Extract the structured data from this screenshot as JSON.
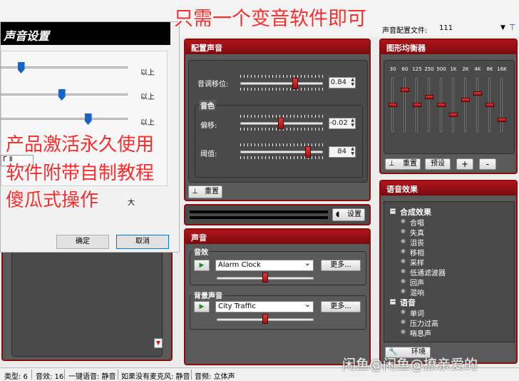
{
  "top": {
    "config_file_label": "声音配置文件:",
    "config_file_value": "111"
  },
  "overlay": {
    "headline": "只需一个变音软件即可",
    "line1": "产品激活永久使用",
    "line2": "软件附带自制教程",
    "line3": "傻瓜式操作"
  },
  "dialog": {
    "title": "声音设置",
    "row_labels": [
      "以上",
      "以上",
      "以上"
    ],
    "slider_levels": [
      0.14,
      0.48,
      0.7
    ],
    "combo_value": "Γ Ⅱ",
    "size_label": "大",
    "ok_label": "确定",
    "cancel_label": "取消"
  },
  "voice_config": {
    "title": "配置声音",
    "pitch_label": "音调移位:",
    "pitch_value": "0.84",
    "pitch_level": 0.68,
    "timbre_group": "音色",
    "offset_label": "偏移:",
    "offset_value": "-0.02",
    "offset_level": 0.49,
    "threshold_label": "阈值:",
    "threshold_value": "84",
    "threshold_level": 0.84,
    "reset_label": "重置"
  },
  "monitor": {
    "settings_label": "设置"
  },
  "sound": {
    "title": "声音",
    "effects_group": "音效",
    "effect_value": "Alarm Clock",
    "effect_more": "更多...",
    "effect_level": 0.5,
    "bg_group": "背景声音",
    "bg_value": "City Traffic",
    "bg_more": "更多...",
    "bg_level": 0.5
  },
  "equalizer": {
    "title": "图形均衡器",
    "bands": [
      "30",
      "60",
      "125",
      "250",
      "500",
      "1K",
      "2K",
      "4K",
      "8K",
      "16K"
    ],
    "levels": [
      0.5,
      0.8,
      0.5,
      0.66,
      0.5,
      0.3,
      0.6,
      0.73,
      0.5,
      0.2
    ],
    "reset_label": "重置",
    "preset_label": "预设",
    "plus_label": "+",
    "minus_label": "-"
  },
  "voice_effects": {
    "title": "语音效果",
    "group1": "合成效果",
    "items1": [
      "合唱",
      "失真",
      "沮丧",
      "移相",
      "采样",
      "低通滤波器",
      "回声",
      "混响"
    ],
    "group2": "语音",
    "items2": [
      "单词",
      "压力过高",
      "喘息声"
    ],
    "env_label": "环境"
  },
  "status": {
    "type": "类型: 6",
    "effects": "音效: 16",
    "mute_key": "一键语音: 静音",
    "no_mic": "如果没有麦克风: 静音",
    "channel": "音频: 立体声"
  },
  "watermark": "闲鱼@闲鱼@撩亲爱的"
}
